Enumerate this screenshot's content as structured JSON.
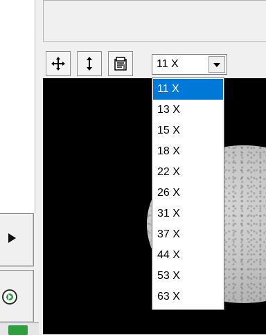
{
  "toolbar": {
    "buttons": [
      {
        "icon": "move-icon"
      },
      {
        "icon": "vertical-resize-icon"
      },
      {
        "icon": "properties-icon"
      }
    ]
  },
  "zoom_combo": {
    "value": "11 X",
    "options": [
      "11 X",
      "13 X",
      "15 X",
      "18 X",
      "22 X",
      "26 X",
      "31 X",
      "37 X",
      "44 X",
      "53 X",
      "63 X"
    ],
    "selected": "11 X"
  },
  "left_panel": {
    "play_icon": "play-icon",
    "nav_icon": "navigate-forward-icon"
  },
  "colors": {
    "selection": "#0078d7",
    "viewer_background": "#000000"
  }
}
